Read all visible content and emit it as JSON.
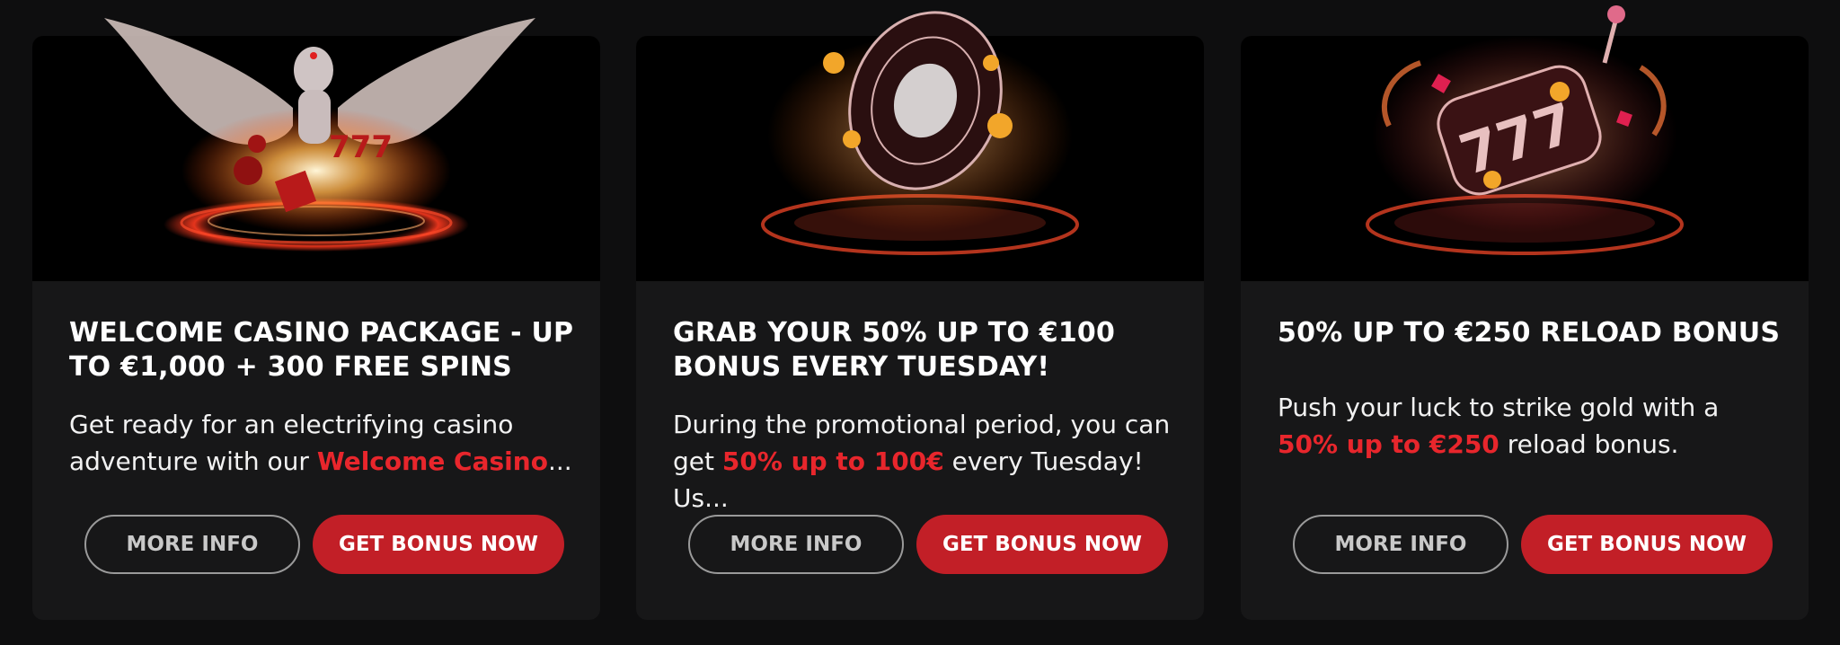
{
  "colors": {
    "accent": "#c21f27",
    "highlight": "#e8262c",
    "card_bg": "#171718",
    "page_bg": "#0e0e0f"
  },
  "cards": [
    {
      "title": "WELCOME CASINO PACKAGE - UP TO €1,000 + 300 FREE SPINS",
      "desc_pre": "Get ready for an electrifying casino adventure with our ",
      "desc_hl": "Welcome Casino",
      "desc_post": "...",
      "more_label": "MORE INFO",
      "bonus_label": "GET BONUS NOW",
      "image": "winged-statue-casino-image"
    },
    {
      "title": "GRAB YOUR 50% UP TO €100 BONUS EVERY TUESDAY!",
      "desc_pre": "During the promotional period, you can get ",
      "desc_hl": "50% up to 100€",
      "desc_post": " every Tuesday! Us...",
      "more_label": "MORE INFO",
      "bonus_label": "GET BONUS NOW",
      "image": "roulette-wheel-image"
    },
    {
      "title": "50% UP TO €250 RELOAD BONUS",
      "desc_pre": "Push your luck to strike gold with a ",
      "desc_hl": "50% up to €250",
      "desc_post": " reload bonus.",
      "more_label": "MORE INFO",
      "bonus_label": "GET BONUS NOW",
      "image": "slot-machine-777-image"
    }
  ]
}
